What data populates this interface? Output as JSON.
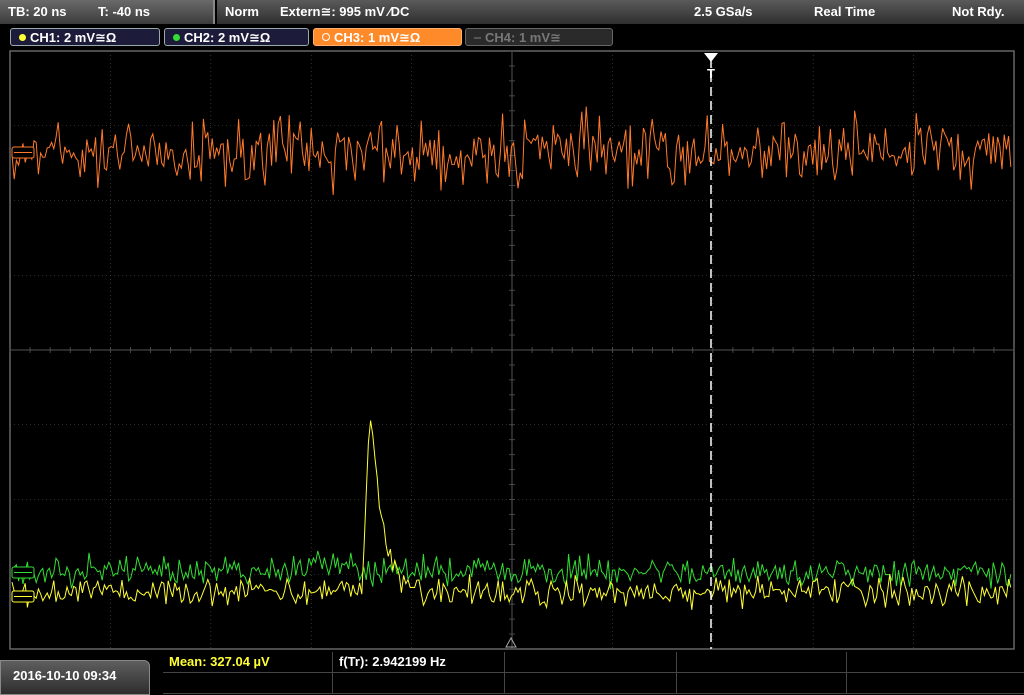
{
  "topbar": {
    "timebase": "TB: 20 ns",
    "trigger_time": "T: -40 ns",
    "mode": "Norm",
    "trigger_source": "Extern≅: 995 mV ⁄DC",
    "sample_rate": "2.5 GSa/s",
    "acq_mode": "Real Time",
    "status": "Not Rdy."
  },
  "channels": [
    {
      "label": "CH1: 2 mV≅Ω",
      "color": "#ffff33"
    },
    {
      "label": "CH2: 2 mV≅Ω",
      "color": "#33dd33"
    },
    {
      "label": "CH3: 1 mV≅Ω",
      "color": "#ff8a2a"
    },
    {
      "label": "CH4: 1 mV≅",
      "color": "#777777"
    }
  ],
  "trigger_marker": "T",
  "bottombar": {
    "datetime": "2016-10-10 09:34",
    "mean": "Mean: 327.04 µV",
    "frequency": "f(Tr): 2.942199 Hz"
  },
  "colors": {
    "ch1": "#ffff33",
    "ch2": "#33dd33",
    "ch3": "#ff7a2a",
    "grid": "#555555"
  }
}
